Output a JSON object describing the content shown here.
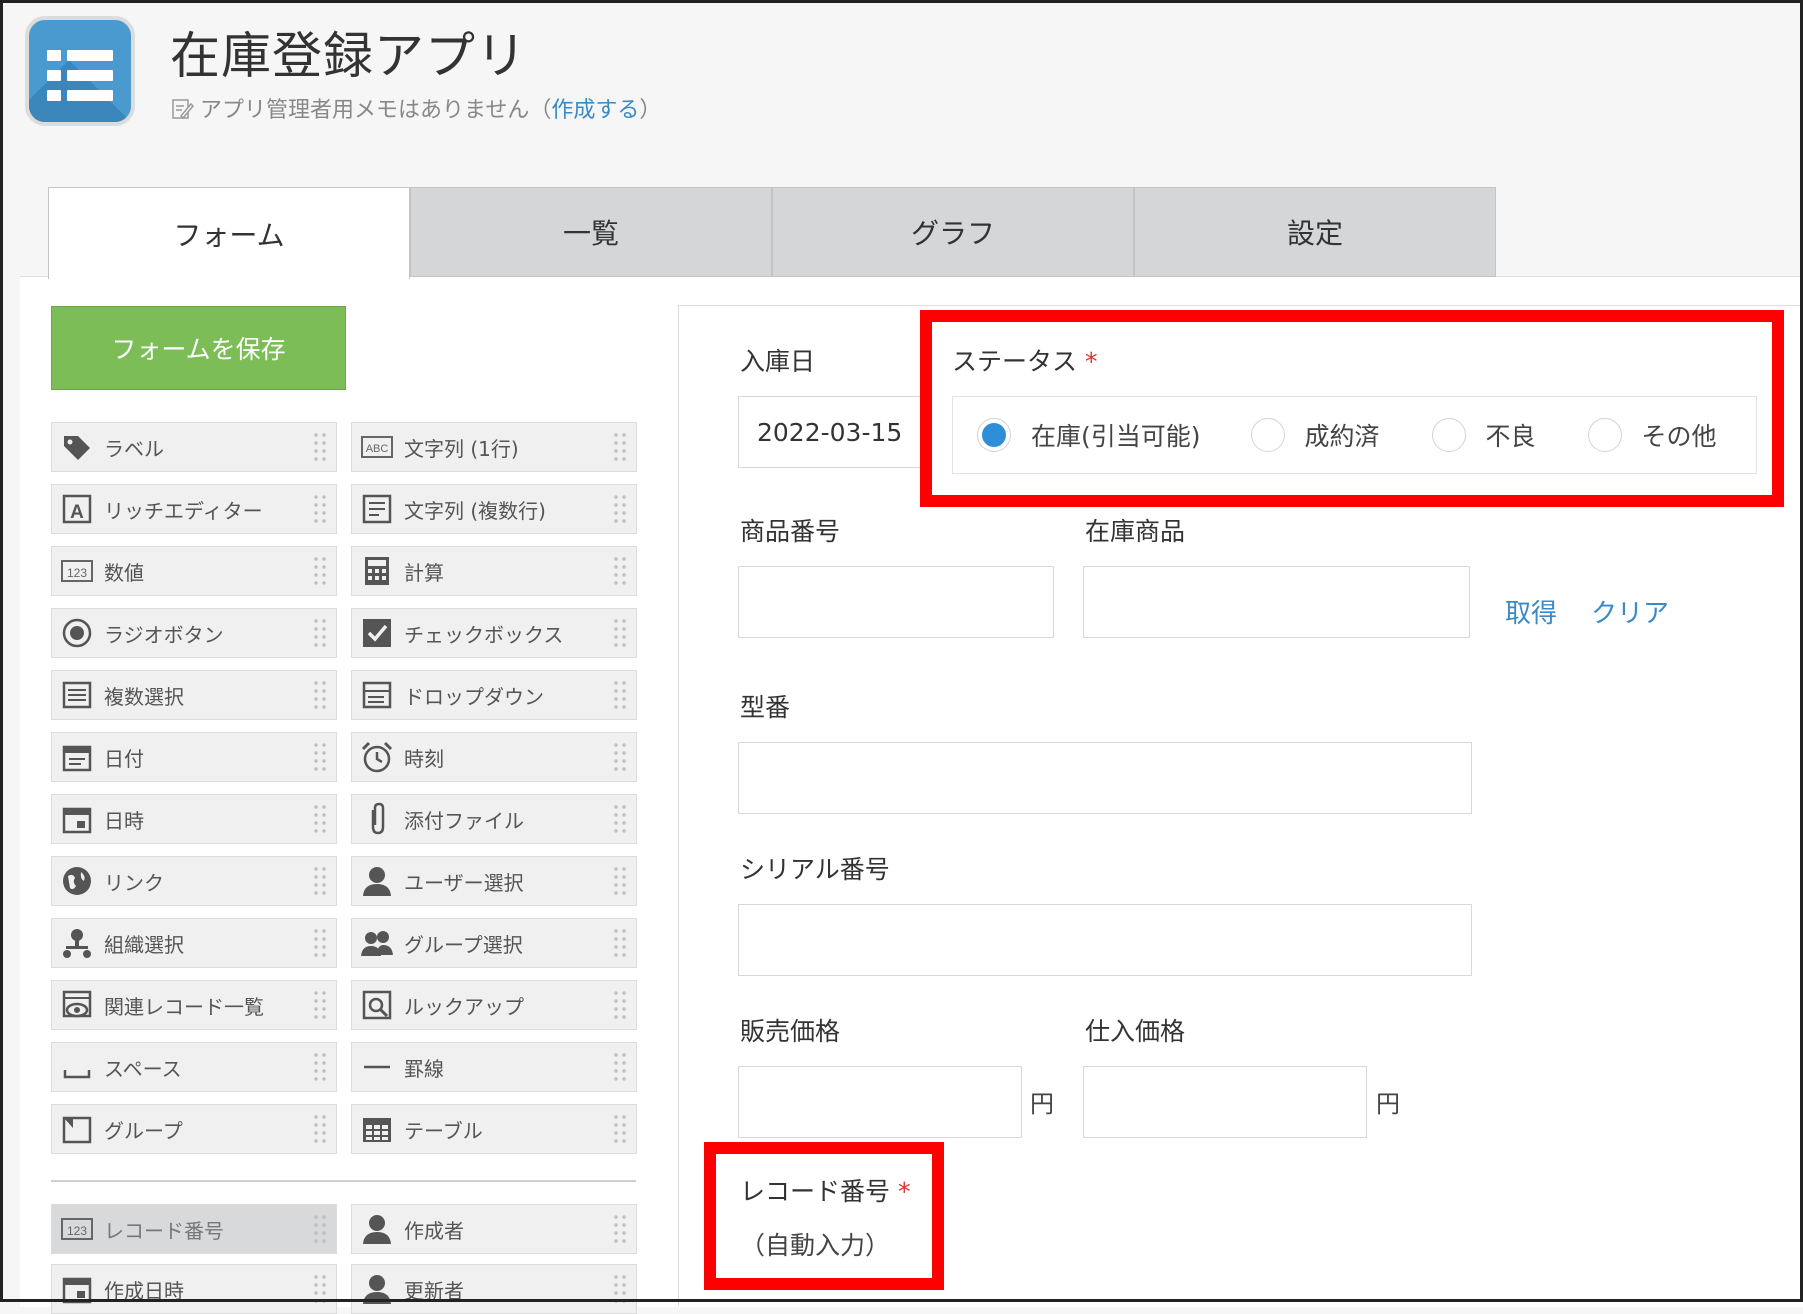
{
  "header": {
    "app_title": "在庫登録アプリ",
    "memo_text": "アプリ管理者用メモはありません",
    "memo_open": "（",
    "memo_link": "作成する",
    "memo_close": "）"
  },
  "tabs": [
    "フォーム",
    "一覧",
    "グラフ",
    "設定"
  ],
  "palette": {
    "save_label": "フォームを保存",
    "left": [
      {
        "label": "ラベル",
        "icon": "label-icon"
      },
      {
        "label": "リッチエディター",
        "icon": "rich-editor-icon"
      },
      {
        "label": "数値",
        "icon": "number-icon"
      },
      {
        "label": "ラジオボタン",
        "icon": "radio-button-icon"
      },
      {
        "label": "複数選択",
        "icon": "multi-select-icon"
      },
      {
        "label": "日付",
        "icon": "date-icon"
      },
      {
        "label": "日時",
        "icon": "datetime-icon"
      },
      {
        "label": "リンク",
        "icon": "link-globe-icon"
      },
      {
        "label": "組織選択",
        "icon": "org-select-icon"
      },
      {
        "label": "関連レコード一覧",
        "icon": "related-records-icon"
      },
      {
        "label": "スペース",
        "icon": "space-icon"
      },
      {
        "label": "グループ",
        "icon": "group-icon"
      }
    ],
    "right": [
      {
        "label": "文字列 (1行)",
        "icon": "text-single-icon"
      },
      {
        "label": "文字列 (複数行)",
        "icon": "text-multi-icon"
      },
      {
        "label": "計算",
        "icon": "calculator-icon"
      },
      {
        "label": "チェックボックス",
        "icon": "checkbox-icon"
      },
      {
        "label": "ドロップダウン",
        "icon": "dropdown-icon"
      },
      {
        "label": "時刻",
        "icon": "alarm-clock-icon"
      },
      {
        "label": "添付ファイル",
        "icon": "paperclip-icon"
      },
      {
        "label": "ユーザー選択",
        "icon": "user-icon"
      },
      {
        "label": "グループ選択",
        "icon": "group-users-icon"
      },
      {
        "label": "ルックアップ",
        "icon": "lookup-icon"
      },
      {
        "label": "罫線",
        "icon": "line-icon"
      },
      {
        "label": "テーブル",
        "icon": "table-icon"
      }
    ],
    "system_left": [
      {
        "label": "レコード番号",
        "icon": "number-icon"
      },
      {
        "label": "作成日時",
        "icon": "datetime-icon"
      }
    ],
    "system_right": [
      {
        "label": "作成者",
        "icon": "user-icon"
      },
      {
        "label": "更新者",
        "icon": "user-icon"
      }
    ]
  },
  "form": {
    "entry_date_label": "入庫日",
    "entry_date_value": "2022-03-15",
    "status_label": "ステータス",
    "required_mark": "*",
    "status_options": [
      {
        "label": "在庫(引当可能)",
        "selected": true
      },
      {
        "label": "成約済",
        "selected": false
      },
      {
        "label": "不良",
        "selected": false
      },
      {
        "label": "その他",
        "selected": false
      }
    ],
    "product_number_label": "商品番号",
    "stock_item_label": "在庫商品",
    "fetch_link": "取得",
    "clear_link": "クリア",
    "model_label": "型番",
    "serial_label": "シリアル番号",
    "sale_price_label": "販売価格",
    "purchase_price_label": "仕入価格",
    "currency_unit": "円",
    "record_number_label": "レコード番号",
    "auto_input": "（自動入力）"
  },
  "colors": {
    "accent_blue": "#3a8ac6",
    "save_green": "#7dbd58",
    "highlight_red": "#ff0000",
    "required_red": "#e03030"
  }
}
